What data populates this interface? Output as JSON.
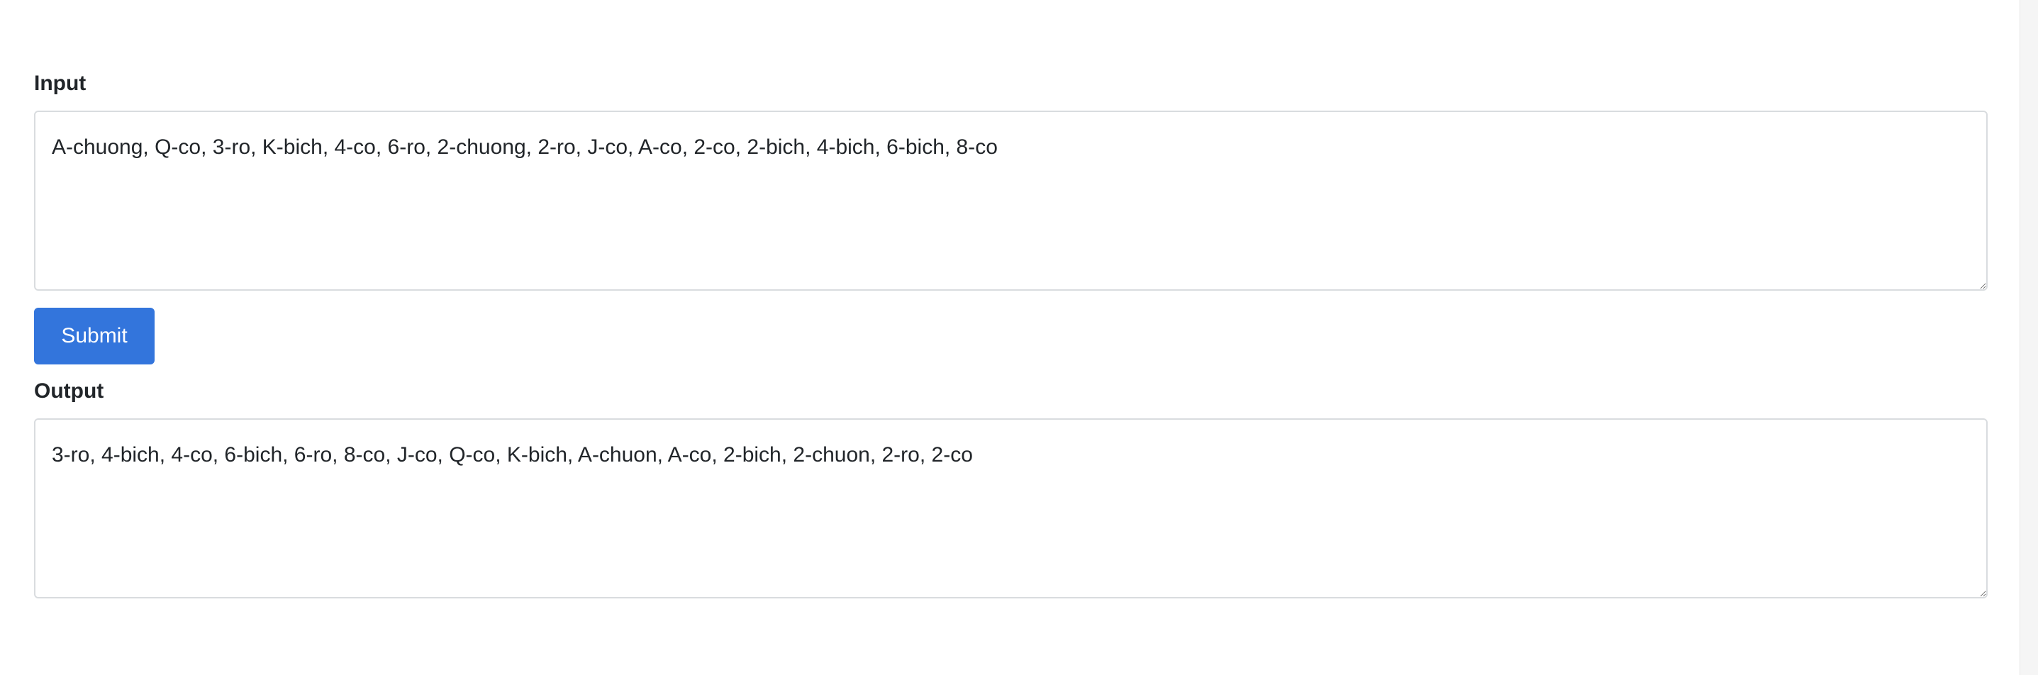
{
  "input": {
    "label": "Input",
    "value": "A-chuong, Q-co, 3-ro, K-bich, 4-co, 6-ro, 2-chuong, 2-ro, J-co, A-co, 2-co, 2-bich, 4-bich, 6-bich, 8-co"
  },
  "submit": {
    "label": "Submit"
  },
  "output": {
    "label": "Output",
    "value": "3-ro, 4-bich, 4-co, 6-bich, 6-ro, 8-co, J-co, Q-co, K-bich, A-chuon, A-co, 2-bich, 2-chuon, 2-ro, 2-co"
  },
  "colors": {
    "accent": "#3375dc",
    "border": "#d9dcdf",
    "text": "#212529"
  }
}
